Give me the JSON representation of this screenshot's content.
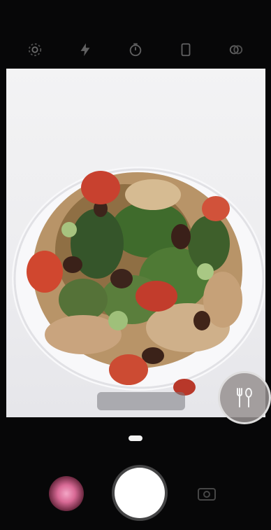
{
  "status_bar": {
    "text": ""
  },
  "top_toolbar": {
    "icons": [
      "settings-icon",
      "flash-icon",
      "timer-icon",
      "aspect-ratio-icon",
      "filter-icon"
    ]
  },
  "viewfinder": {
    "scene_label": "",
    "food_mode_icon": "fork-spoon-icon"
  },
  "modes": {
    "items": [
      "",
      "",
      "",
      "",
      ""
    ],
    "active_index": 2
  },
  "bottom_controls": {
    "gallery_icon": "gallery-thumbnail",
    "shutter_icon": "shutter",
    "switch_icon": "switch-camera-icon"
  },
  "colors": {
    "background": "#070708",
    "viewfinder": "#efeff1",
    "accent_pink": "#d96a96",
    "shutter": "#ffffff",
    "food_button": "#969191"
  }
}
